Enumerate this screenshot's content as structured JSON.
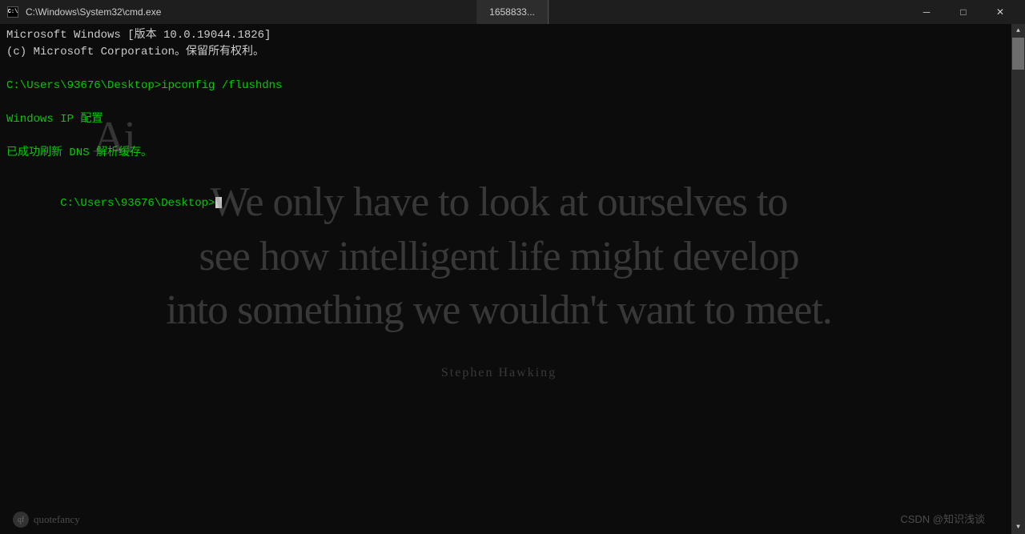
{
  "window": {
    "title": "C:\\Windows\\System32\\cmd.exe",
    "tab_label": "1658833...",
    "icon_text": "C:\\",
    "btn_minimize": "─",
    "btn_restore": "□",
    "btn_close": "✕"
  },
  "terminal": {
    "line1": "Microsoft Windows [版本 10.0.19044.1826]",
    "line2": "(c) Microsoft Corporation。保留所有权利。",
    "line3": "",
    "line4": "C:\\Users\\93676\\Desktop>ipconfig /flushdns",
    "line5": "",
    "line6": "Windows IP 配置",
    "line7": "",
    "line8": "已成功刷新 DNS 解析缓存。",
    "line9": "",
    "line10": "C:\\Users\\93676\\Desktop>"
  },
  "quote": {
    "ai_text": "Ai",
    "main_line1": "We only have to look at ourselves to",
    "main_line2": "see how  intelligent life might develop",
    "main_line3": "into something we wouldn't want to meet.",
    "author": "Stephen Hawking"
  },
  "watermarks": {
    "quotefancy": "quotefancy",
    "csdn": "CSDN @知识浅谈"
  }
}
